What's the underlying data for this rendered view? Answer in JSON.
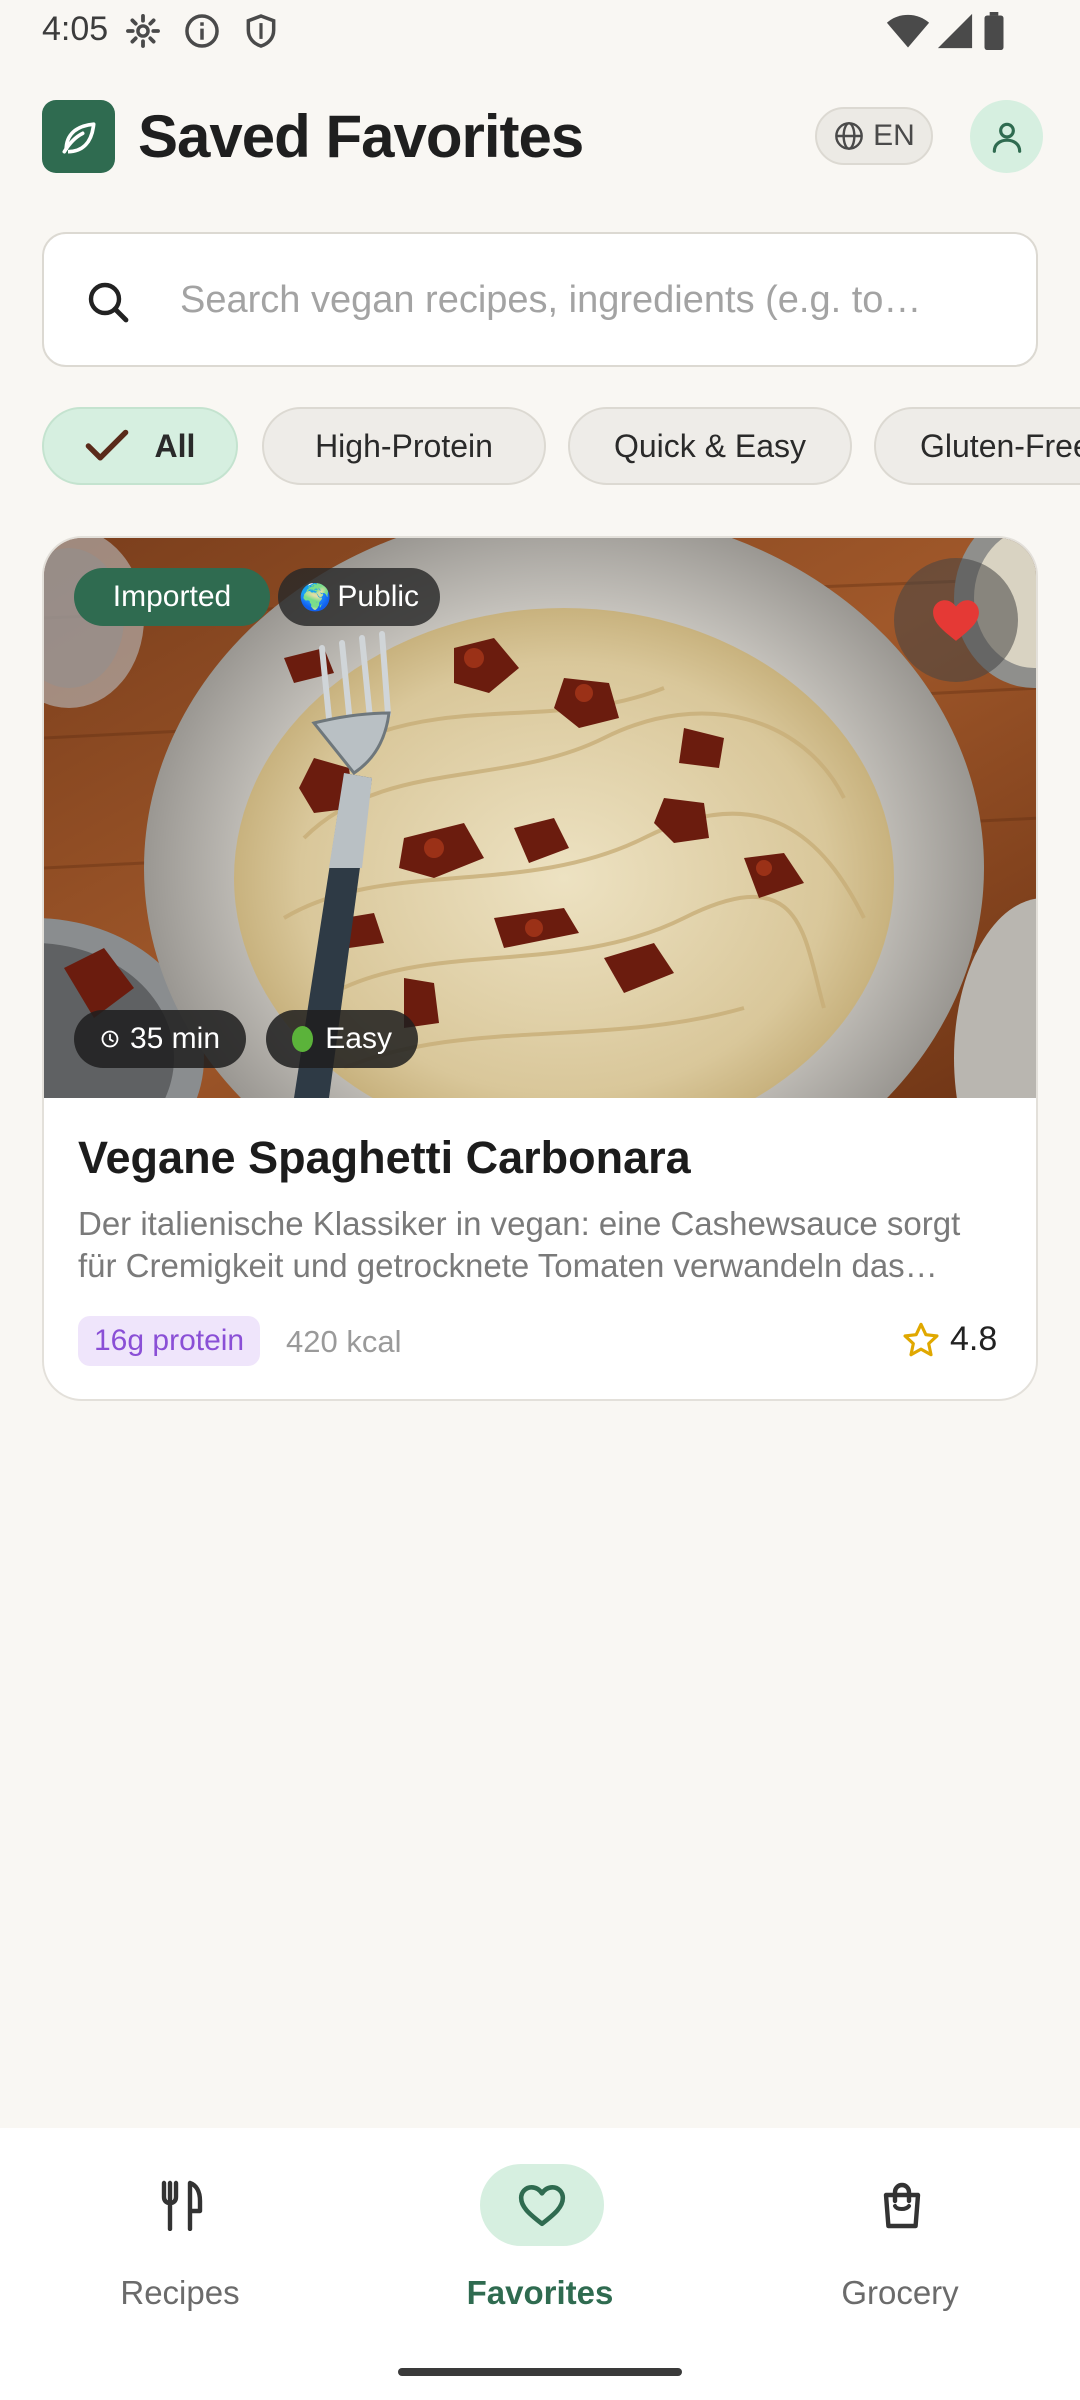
{
  "status_bar": {
    "time": "4:05",
    "left_icons": [
      "gear-icon",
      "info-icon",
      "shield-icon"
    ],
    "right_icons": [
      "wifi-icon",
      "signal-icon",
      "battery-icon"
    ]
  },
  "header": {
    "title": "Saved Favorites",
    "logo_icon": "leaf-icon",
    "language": "EN",
    "profile_icon": "user-icon"
  },
  "search": {
    "placeholder": "Search vegan recipes, ingredients (e.g. to…",
    "value": ""
  },
  "filters": {
    "chips": [
      {
        "label": "All",
        "active": true
      },
      {
        "label": "High-Protein",
        "active": false
      },
      {
        "label": "Quick & Easy",
        "active": false
      },
      {
        "label": "Gluten-Free",
        "active": false
      }
    ]
  },
  "recipe": {
    "badge_imported": "Imported",
    "badge_public": "Public",
    "time": "35 min",
    "difficulty": "Easy",
    "favorited": true,
    "title": "Vegane Spaghetti Carbonara",
    "description": "Der italienische Klassiker in vegan: eine Cashewsauce sorgt für Cremigkeit und getrocknete Tomaten verwandeln das Gericht in einen Genuss.",
    "protein": "16g protein",
    "kcal": "420 kcal",
    "rating": "4.8"
  },
  "bottom_nav": {
    "items": [
      {
        "label": "Recipes",
        "icon": "fork-knife-icon",
        "active": false
      },
      {
        "label": "Favorites",
        "icon": "heart-icon",
        "active": true
      },
      {
        "label": "Grocery",
        "icon": "shopping-bag-icon",
        "active": false
      }
    ]
  },
  "colors": {
    "background": "#f9f7f3",
    "primary": "#2f6b50",
    "active_tint": "#d6efe0",
    "heart": "#e53935",
    "protein_text": "#8a4fd6",
    "star": "#e0a800"
  }
}
